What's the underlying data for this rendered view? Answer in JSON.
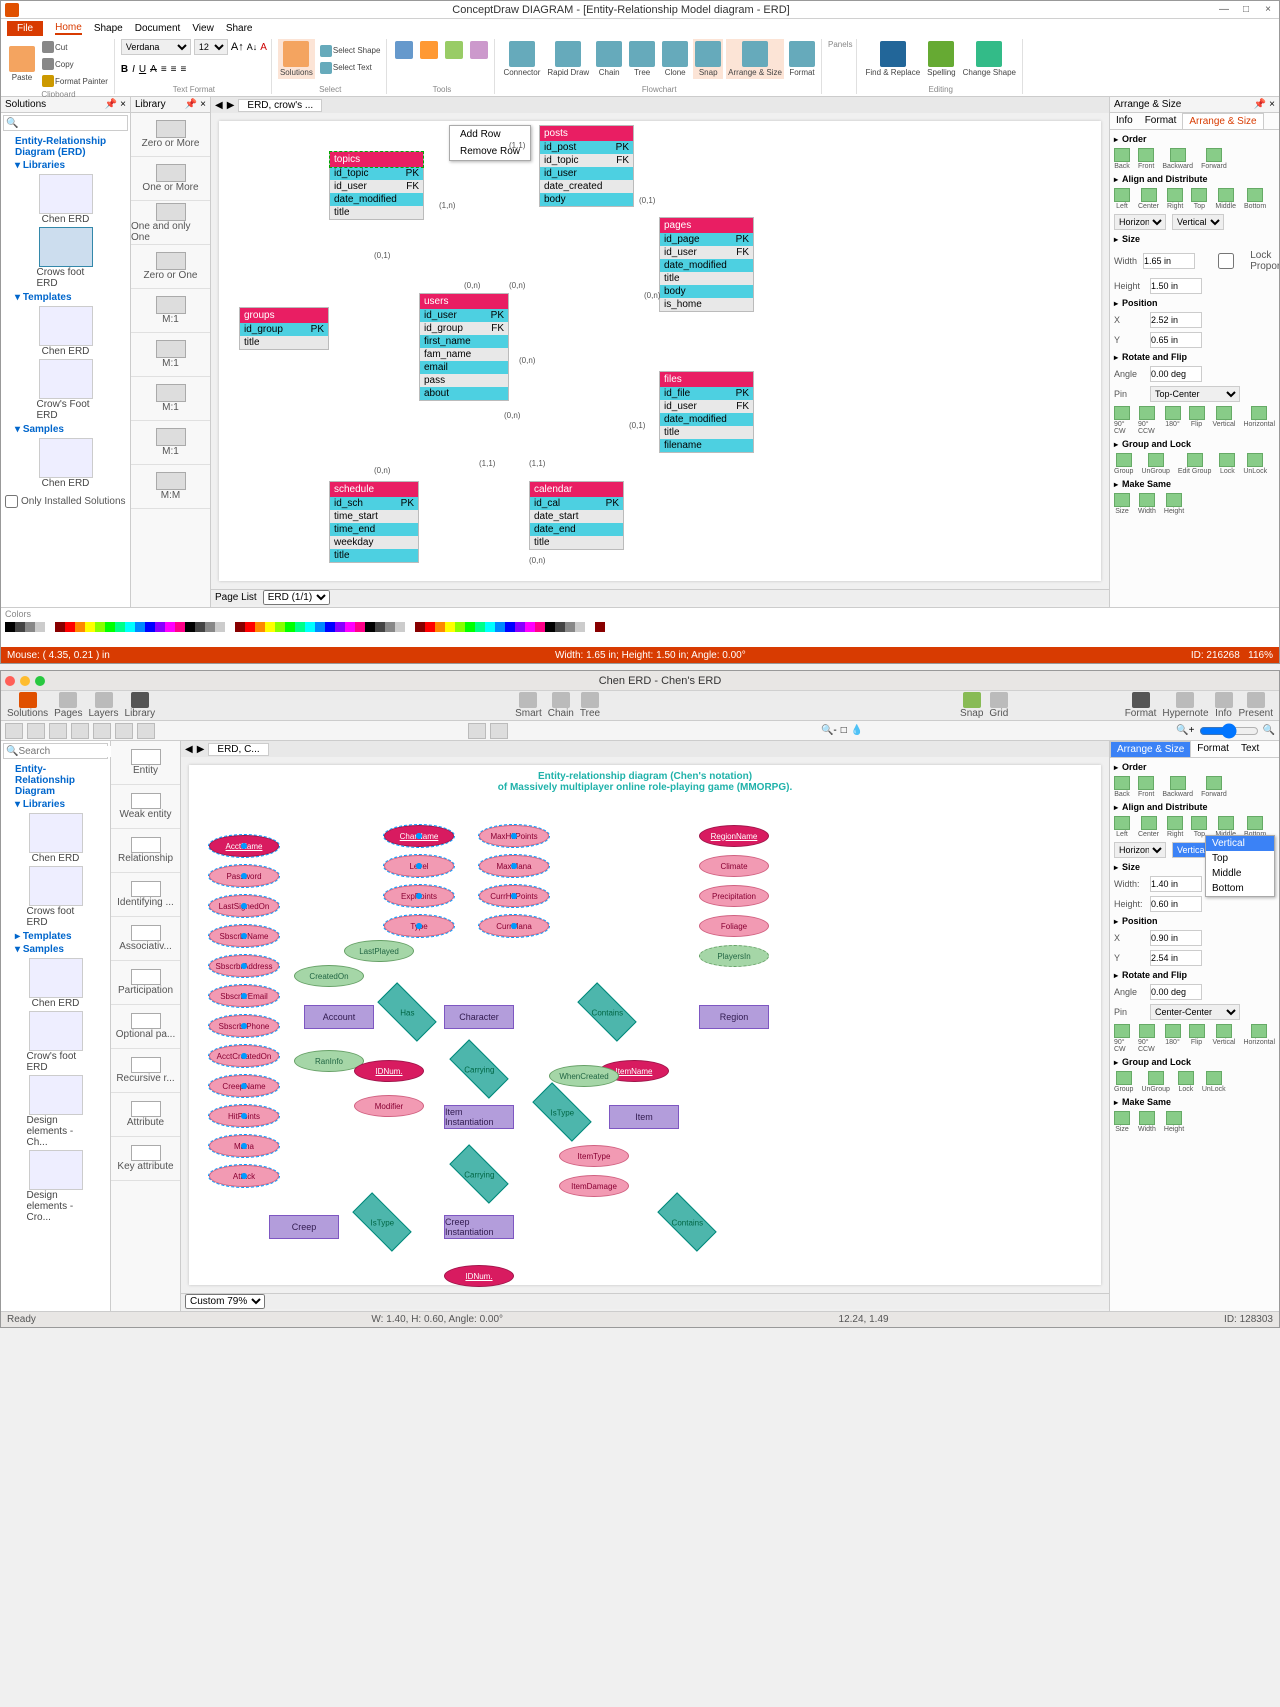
{
  "win1": {
    "title": "ConceptDraw DIAGRAM - [Entity-Relationship Model diagram - ERD]",
    "menu": {
      "file": "File",
      "home": "Home",
      "shape": "Shape",
      "document": "Document",
      "view": "View",
      "share": "Share"
    },
    "ribbon": {
      "clipboard": {
        "paste": "Paste",
        "cut": "Cut",
        "copy": "Copy",
        "fmt": "Format Painter",
        "label": "Clipboard"
      },
      "font": {
        "name": "Verdana",
        "size": "12",
        "label": "Text Format"
      },
      "select": {
        "selshape": "Select Shape",
        "seltext": "Select Text",
        "solutions": "Solutions",
        "label": "Select"
      },
      "tools": {
        "label": "Tools"
      },
      "flowchart": {
        "connector": "Connector",
        "rapid": "Rapid Draw",
        "chain": "Chain",
        "tree": "Tree",
        "clone": "Clone",
        "snap": "Snap",
        "arrange": "Arrange & Size",
        "format": "Format",
        "label": "Flowchart"
      },
      "panels": {
        "label": "Panels"
      },
      "editing": {
        "find": "Find & Replace",
        "spell": "Spelling",
        "change": "Change Shape",
        "label": "Editing"
      }
    },
    "solutions": {
      "title": "Solutions",
      "erd": "Entity-Relationship Diagram (ERD)",
      "libs": "Libraries",
      "tmpl": "Templates",
      "samp": "Samples",
      "items": [
        "Chen ERD",
        "Crows foot ERD",
        "Chen ERD",
        "Crow's Foot ERD",
        "Chen ERD"
      ],
      "onlyInstalled": "Only Installed Solutions"
    },
    "library": {
      "title": "Library",
      "items": [
        "Zero or More",
        "One or More",
        "One and only One",
        "Zero or One",
        "M:1",
        "M:1",
        "M:1",
        "M:1",
        "M:M"
      ]
    },
    "canvas": {
      "tab": "ERD, crow's ...",
      "ctx": {
        "add": "Add Row",
        "remove": "Remove Row"
      },
      "tables": {
        "topics": {
          "name": "topics",
          "rows": [
            [
              "id_topic",
              "PK"
            ],
            [
              "id_user",
              "FK"
            ],
            [
              "date_modified",
              ""
            ],
            [
              "title",
              ""
            ]
          ]
        },
        "posts": {
          "name": "posts",
          "rows": [
            [
              "id_post",
              "PK"
            ],
            [
              "id_topic",
              "FK"
            ],
            [
              "id_user",
              ""
            ],
            [
              "date_created",
              ""
            ],
            [
              "body",
              ""
            ]
          ]
        },
        "pages": {
          "name": "pages",
          "rows": [
            [
              "id_page",
              "PK"
            ],
            [
              "id_user",
              "FK"
            ],
            [
              "date_modified",
              ""
            ],
            [
              "title",
              ""
            ],
            [
              "body",
              ""
            ],
            [
              "is_home",
              ""
            ]
          ]
        },
        "groups": {
          "name": "groups",
          "rows": [
            [
              "id_group",
              "PK"
            ],
            [
              "title",
              ""
            ]
          ]
        },
        "users": {
          "name": "users",
          "rows": [
            [
              "id_user",
              "PK"
            ],
            [
              "id_group",
              "FK"
            ],
            [
              "first_name",
              ""
            ],
            [
              "fam_name",
              ""
            ],
            [
              "email",
              ""
            ],
            [
              "pass",
              ""
            ],
            [
              "about",
              ""
            ]
          ]
        },
        "files": {
          "name": "files",
          "rows": [
            [
              "id_file",
              "PK"
            ],
            [
              "id_user",
              "FK"
            ],
            [
              "date_modified",
              ""
            ],
            [
              "title",
              ""
            ],
            [
              "filename",
              ""
            ]
          ]
        },
        "schedule": {
          "name": "schedule",
          "rows": [
            [
              "id_sch",
              "PK"
            ],
            [
              "time_start",
              ""
            ],
            [
              "time_end",
              ""
            ],
            [
              "weekday",
              ""
            ],
            [
              "title",
              ""
            ]
          ]
        },
        "calendar": {
          "name": "calendar",
          "rows": [
            [
              "id_cal",
              "PK"
            ],
            [
              "date_start",
              ""
            ],
            [
              "date_end",
              ""
            ],
            [
              "title",
              ""
            ]
          ]
        }
      },
      "cards": [
        "(1,1)",
        "(1,n)",
        "(0,1)",
        "(0,n)",
        "(0,n)",
        "(0,1)",
        "(0,n)",
        "(0,n)",
        "(0,n)",
        "(1,1)",
        "(0,n)",
        "(1,1)",
        "(0,1)",
        "(0,n)"
      ],
      "pagelist": "Page List",
      "pagename": "ERD (1/1)"
    },
    "arrange": {
      "title": "Arrange & Size",
      "tabs": [
        "Info",
        "Format",
        "Arrange & Size"
      ],
      "order": {
        "hd": "Order",
        "back": "Back",
        "front": "Front",
        "backward": "Backward",
        "forward": "Forward"
      },
      "align": {
        "hd": "Align and Distribute",
        "left": "Left",
        "center": "Center",
        "right": "Right",
        "top": "Top",
        "middle": "Middle",
        "bottom": "Bottom",
        "horiz": "Horizontal",
        "vert": "Vertical"
      },
      "size": {
        "hd": "Size",
        "w": "Width",
        "wv": "1.65 in",
        "h": "Height",
        "hv": "1.50 in",
        "lock": "Lock Proportions"
      },
      "pos": {
        "hd": "Position",
        "x": "X",
        "xv": "2.52 in",
        "y": "Y",
        "yv": "0.65 in"
      },
      "rot": {
        "hd": "Rotate and Flip",
        "angle": "Angle",
        "av": "0.00 deg",
        "pin": "Pin",
        "pv": "Top-Center",
        "cw": "90° CW",
        "ccw": "90° CCW",
        "r180": "180°",
        "flip": "Flip",
        "vert": "Vertical",
        "horiz": "Horizontal"
      },
      "grp": {
        "hd": "Group and Lock",
        "group": "Group",
        "ungroup": "UnGroup",
        "edit": "Edit Group",
        "lock": "Lock",
        "unlock": "UnLock"
      },
      "same": {
        "hd": "Make Same",
        "size": "Size",
        "width": "Width",
        "height": "Height"
      }
    },
    "colors": "Colors",
    "status": {
      "mouse": "Mouse: ( 4.35, 0.21 ) in",
      "dims": "Width: 1.65 in; Height: 1.50 in; Angle: 0.00°",
      "id": "ID: 216268",
      "zoom": "116%"
    }
  },
  "win2": {
    "title": "Chen ERD - Chen's ERD",
    "toolbar": {
      "solutions": "Solutions",
      "pages": "Pages",
      "layers": "Layers",
      "library": "Library",
      "smart": "Smart",
      "chain": "Chain",
      "tree": "Tree",
      "snap": "Snap",
      "grid": "Grid",
      "format": "Format",
      "hypernote": "Hypernote",
      "info": "Info",
      "present": "Present"
    },
    "search_ph": "Search",
    "solutions": {
      "erd": "Entity-Relationship Diagram",
      "libs": "Libraries",
      "tmpl": "Templates",
      "samp": "Samples",
      "items": [
        "Chen ERD",
        "Crows foot ERD",
        "Chen ERD",
        "Crow's foot ERD",
        "Design elements - Ch...",
        "Design elements - Cro..."
      ]
    },
    "library": {
      "items": [
        "Entity",
        "Weak entity",
        "Relationship",
        "Identifying ...",
        "Associativ...",
        "Participation",
        "Optional pa...",
        "Recursive r...",
        "Attribute",
        "Key attribute"
      ]
    },
    "canvas": {
      "tab": "ERD, C...",
      "title1": "Entity-relationship diagram (Chen's notation)",
      "title2": "of Massively multiplayer online role-playing game (MMORPG).",
      "attrs": {
        "account": [
          "AcctName",
          "Password",
          "LastSignedOn",
          "SbscrbrName",
          "SbscrbrAddress",
          "SbscrbrEmail",
          "SbscrbrPhone",
          "AcctCreatedOn",
          "CreepName",
          "HitPoints",
          "Mana",
          "Attack"
        ],
        "acct_extra": [
          "CreatedOn",
          "LastPlayed",
          "RanInfo",
          "IDNum.",
          "Modifier"
        ],
        "character": [
          "CharName",
          "Level",
          "ExpPoints",
          "Type"
        ],
        "char2": [
          "MaxHitPoints",
          "MaxMana",
          "CurrHitPoints",
          "CurrMana"
        ],
        "region": [
          "RegionName",
          "Climate",
          "Precipitation",
          "Foliage",
          "PlayersIn"
        ],
        "item": [
          "ItemName",
          "ItemType",
          "ItemDamage",
          "WhenCreated",
          "IDNum."
        ]
      },
      "ents": [
        "Account",
        "Character",
        "Region",
        "Item Instantiation",
        "Item",
        "Creep",
        "Creep Instantiation"
      ],
      "rels": [
        "Has",
        "Contains",
        "Carrying",
        "IsType",
        "Carrying",
        "IsType",
        "Contains"
      ],
      "zoom": "Custom 79%"
    },
    "arrange": {
      "title": "Arrange & Size",
      "fmt": "Format",
      "txt": "Text",
      "order": {
        "hd": "Order",
        "back": "Back",
        "front": "Front",
        "backward": "Backward",
        "forward": "Forward"
      },
      "align": {
        "hd": "Align and Distribute",
        "left": "Left",
        "center": "Center",
        "right": "Right",
        "top": "Top",
        "middle": "Middle",
        "bottom": "Bottom",
        "horiz": "Horizontal",
        "vert": "Vertical"
      },
      "dropdown": [
        "Vertical",
        "Top",
        "Middle",
        "Bottom"
      ],
      "size": {
        "hd": "Size",
        "w": "Width:",
        "wv": "1.40 in",
        "h": "Height:",
        "hv": "0.60 in"
      },
      "pos": {
        "hd": "Position",
        "x": "X",
        "xv": "0.90 in",
        "y": "Y",
        "yv": "2.54 in"
      },
      "rot": {
        "hd": "Rotate and Flip",
        "angle": "Angle",
        "av": "0.00 deg",
        "pin": "Pin",
        "pv": "Center-Center",
        "cw": "90° CW",
        "ccw": "90° CCW",
        "r180": "180°",
        "flip": "Flip",
        "vert": "Vertical",
        "horiz": "Horizontal"
      },
      "grp": {
        "hd": "Group and Lock",
        "group": "Group",
        "ungroup": "UnGroup",
        "lock": "Lock",
        "unlock": "UnLock"
      },
      "same": {
        "hd": "Make Same",
        "size": "Size",
        "width": "Width",
        "height": "Height"
      }
    },
    "status": {
      "ready": "Ready",
      "dims": "W: 1.40, H: 0.60, Angle: 0.00°",
      "mouse": "12.24, 1.49",
      "id": "ID: 128303"
    }
  }
}
